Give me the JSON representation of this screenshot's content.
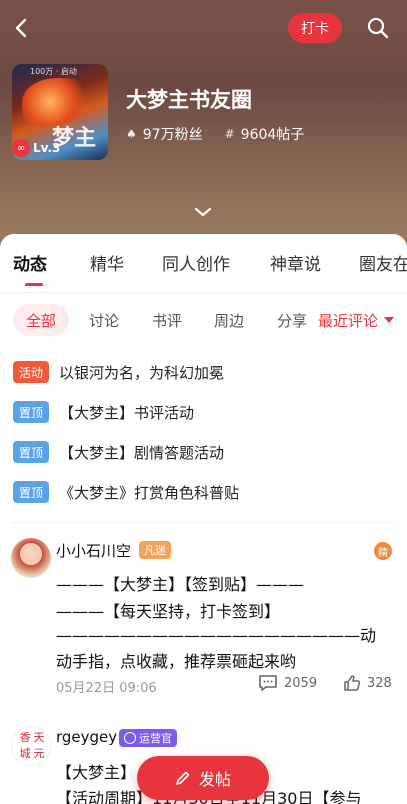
{
  "header": {
    "checkin_label": "打卡",
    "group_name": "大梦主书友圈",
    "fans": "97万粉丝",
    "posts": "9604帖子",
    "cover_toptext": "100万 · 启动",
    "cover_title_art": "梦主",
    "level": "Lv.3"
  },
  "tabs": [
    {
      "label": "动态",
      "active": true
    },
    {
      "label": "精华"
    },
    {
      "label": "同人创作"
    },
    {
      "label": "神章说"
    },
    {
      "label": "圈友在"
    }
  ],
  "filters": [
    "全部",
    "讨论",
    "书评",
    "周边",
    "分享"
  ],
  "sort_label": "最近评论",
  "notices": [
    {
      "badge": "活动",
      "text": "以银河为名，为科幻加冕"
    },
    {
      "badge": "置顶",
      "text": "【大梦主】书评活动"
    },
    {
      "badge": "置顶",
      "text": "【大梦主】剧情答题活动"
    },
    {
      "badge": "置顶",
      "text": "《大梦主》打赏角色科普贴"
    }
  ],
  "posts": [
    {
      "user": "小小石川空",
      "role": "凡迷",
      "essence": "精",
      "lines": [
        "———【大梦主】【签到贴】———",
        "———【每天坚持，打卡签到】",
        "———————————————————动",
        "动手指，点收藏，推荐票砸起来哟"
      ],
      "time": "05月22日 09:06",
      "comments": "2059",
      "likes": "328"
    },
    {
      "user": "rgeygey",
      "role": "运营官",
      "avatar_seal": [
        "香",
        "天",
        "城",
        "元"
      ],
      "lines": [
        "【大梦主】",
        "【活动周期】11月30日至11月30日【参与"
      ]
    }
  ],
  "fab_label": "发帖",
  "colors": {
    "accent": "#e8353d",
    "pin_badge": "#5aa3e8",
    "activity_badge": "#ef5a3a"
  }
}
